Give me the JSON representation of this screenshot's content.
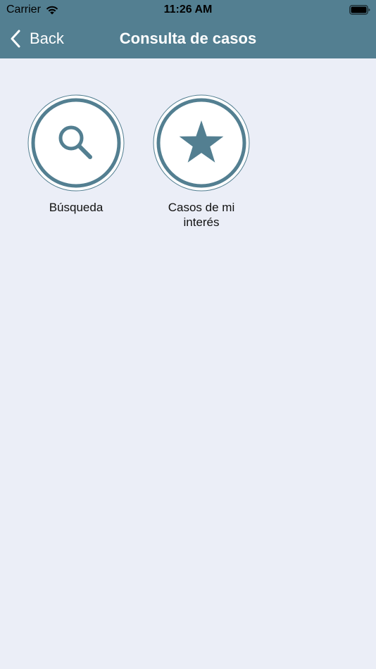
{
  "status_bar": {
    "carrier": "Carrier",
    "time": "11:26 AM",
    "wifi_icon": "wifi-icon",
    "battery_icon": "battery-icon"
  },
  "nav": {
    "back_label": "Back",
    "title": "Consulta de casos"
  },
  "menu": {
    "items": [
      {
        "label": "Búsqueda",
        "icon": "search-icon"
      },
      {
        "label": "Casos de mi interés",
        "icon": "star-icon"
      }
    ]
  },
  "colors": {
    "header": "#537f91",
    "accent": "#537f91",
    "background": "#ebeef7",
    "circle_fill": "#ffffff"
  }
}
